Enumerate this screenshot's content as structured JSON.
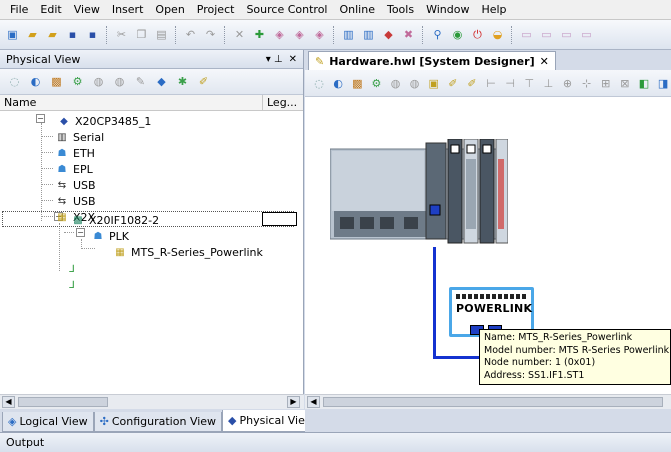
{
  "menu": [
    "File",
    "Edit",
    "View",
    "Insert",
    "Open",
    "Project",
    "Source Control",
    "Online",
    "Tools",
    "Window",
    "Help"
  ],
  "physical_view": {
    "title": "Physical View",
    "pin_glyph": "▾ ⊥",
    "close_glyph": "✕",
    "columns": {
      "name": "Name",
      "legend": "Leg..."
    },
    "tree": {
      "root": "X20CP3485_1",
      "serial": "Serial",
      "eth": "ETH",
      "epl": "EPL",
      "usb1": "USB",
      "usb2": "USB",
      "x2x": "X2X",
      "if_module": "X20IF1082-2",
      "plk": "PLK",
      "device": "MTS_R-Series_Powerlink"
    },
    "tabs": {
      "logical": "Logical View",
      "configuration": "Configuration View",
      "physical": "Physical View"
    }
  },
  "hardware_editor": {
    "tab_title": "Hardware.hwl [System Designer]",
    "close_glyph": "✕",
    "module_label": "POWERLINK",
    "tooltip": {
      "line1": "Name: MTS_R-Series_Powerlink",
      "line2": "Model number: MTS R-Series Powerlink (4)",
      "line3": "Node number: 1 (0x01)",
      "line4": "Address: SS1.IF1.ST1"
    }
  },
  "output_label": "Output",
  "colors": {
    "cable": "#1432d0",
    "module_border": "#4aa7e8",
    "tooltip_bg": "#ffffe1"
  }
}
